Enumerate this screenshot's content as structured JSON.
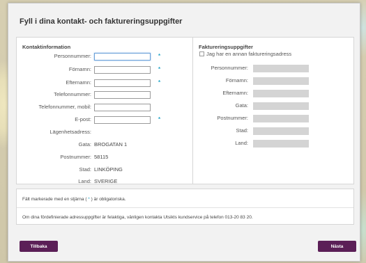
{
  "title": "Fyll i dina kontakt- och faktureringsuppgifter",
  "contact": {
    "title": "Kontaktinformation",
    "fields": [
      {
        "label": "Personnummer:",
        "required": true
      },
      {
        "label": "Förnamn:",
        "required": true
      },
      {
        "label": "Efternamn:",
        "required": true
      },
      {
        "label": "Telefonnummer:",
        "required": false
      },
      {
        "label": "Telefonnummer, mobil:",
        "required": false
      },
      {
        "label": "E-post:",
        "required": true
      }
    ],
    "address_heading": "Lägenhetsadress:",
    "address": [
      {
        "label": "Gata:",
        "value": "BROGATAN 1"
      },
      {
        "label": "Postnummer:",
        "value": "58115"
      },
      {
        "label": "Stad:",
        "value": "LINKÖPING"
      },
      {
        "label": "Land:",
        "value": "SVERIGE"
      }
    ],
    "required_mark": "*"
  },
  "billing": {
    "title": "Faktureringsuppgifter",
    "checkbox_label": "Jag har en annan faktureringsadress",
    "fields": [
      {
        "label": "Personnummer:"
      },
      {
        "label": "Förnamn:"
      },
      {
        "label": "Efternamn:"
      },
      {
        "label": "Gata:"
      },
      {
        "label": "Postnummer:"
      },
      {
        "label": "Stad:"
      },
      {
        "label": "Land:"
      }
    ]
  },
  "notes": {
    "line1_a": "Fält markerade med en stjärna (",
    "line1_star": " * ",
    "line1_b": ") är obligatoriska.",
    "line2": "Om dina fördefinierade adressuppgifter är felaktiga, vänligen kontakta Utsikts kundservice på telefon 013-20 83 20."
  },
  "buttons": {
    "back": "Tillbaka",
    "next": "Nästa"
  },
  "colors": {
    "button": "#5b1f57",
    "required": "#2aa7c9"
  }
}
